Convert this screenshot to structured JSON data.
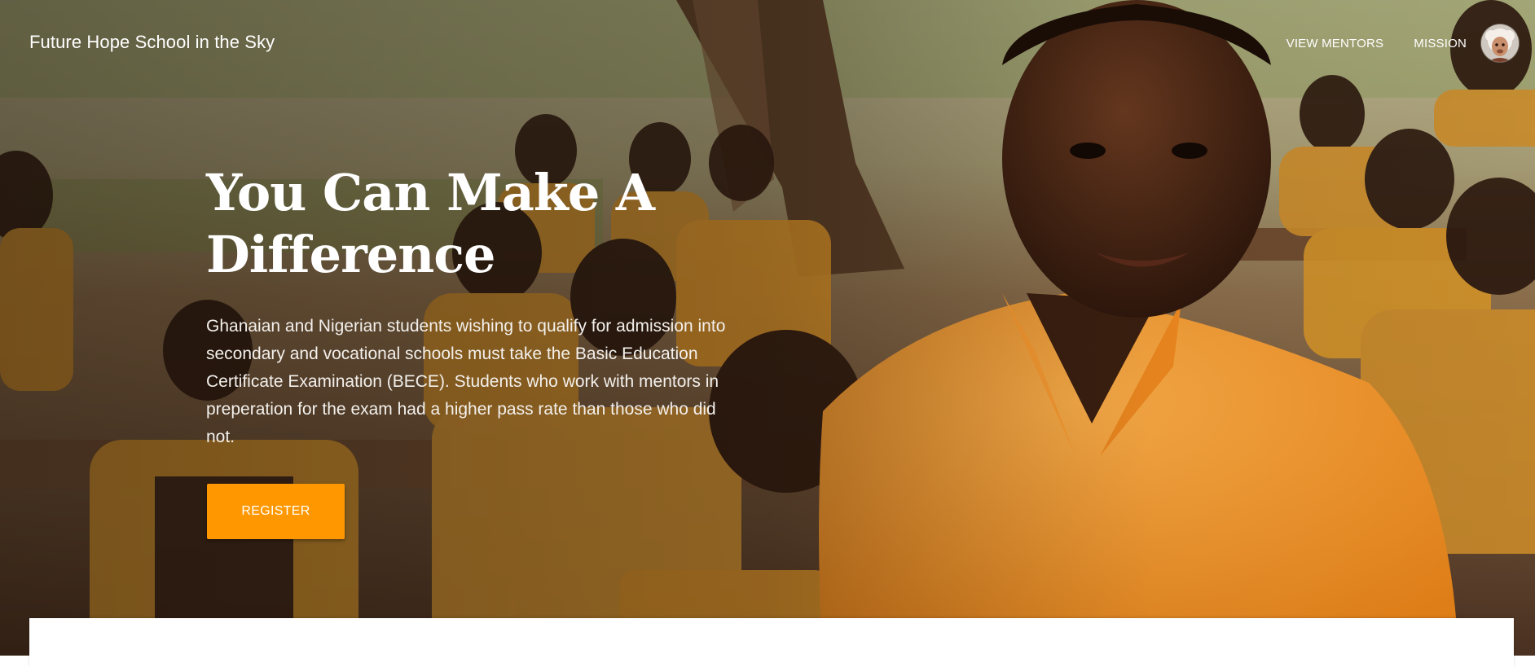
{
  "header": {
    "brand": "Future Hope School in the Sky",
    "nav": [
      {
        "label": "VIEW MENTORS"
      },
      {
        "label": "MISSION"
      }
    ]
  },
  "hero": {
    "title": "You Can Make A Difference",
    "description": "Ghanaian and Nigerian students wishing to qualify for admission into secondary and vocational schools must take the Basic Education Certificate Examination (BECE). Students who work with mentors in preperation for the exam had a higher pass rate than those who did not.",
    "register_label": "REGISTER",
    "image_alt": "Students in orange school uniforms sitting at desks outdoors"
  },
  "colors": {
    "accent": "#ff9800",
    "uniform": "#f39a2c",
    "text": "#ffffff"
  }
}
